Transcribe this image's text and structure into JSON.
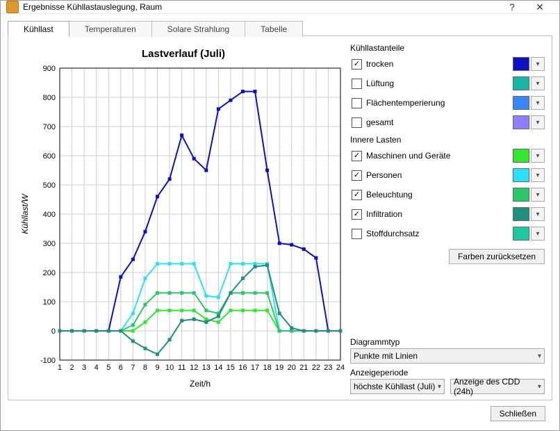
{
  "window_title": "Ergebnisse Kühllastauslegung, Raum",
  "tabs": [
    "Kühllast",
    "Temperaturen",
    "Solare Strahlung",
    "Tabelle"
  ],
  "active_tab": 0,
  "chart_title": "Lastverlauf (Juli)",
  "axis_x_label": "Zeit/h",
  "axis_y_label": "Kühllast/W",
  "groups": {
    "anteile_header": "Kühllastanteile",
    "innere_header": "Innere Lasten"
  },
  "series_anteile": [
    {
      "key": "trocken",
      "label": "trocken",
      "checked": true,
      "color": "#0b10c3"
    },
    {
      "key": "lueftung",
      "label": "Lüftung",
      "checked": false,
      "color": "#17b7a7"
    },
    {
      "key": "flaechentemp",
      "label": "Flächentemperierung",
      "checked": false,
      "color": "#3a86ff"
    },
    {
      "key": "gesamt",
      "label": "gesamt",
      "checked": false,
      "color": "#8d7dff"
    }
  ],
  "series_innere": [
    {
      "key": "maschinen",
      "label": "Maschinen und Geräte",
      "checked": true,
      "color": "#2fe82f"
    },
    {
      "key": "personen",
      "label": "Personen",
      "checked": true,
      "color": "#2be0ff"
    },
    {
      "key": "beleuchtung",
      "label": "Beleuchtung",
      "checked": true,
      "color": "#27c96a"
    },
    {
      "key": "infiltration",
      "label": "Infiltration",
      "checked": true,
      "color": "#1f8f7f"
    },
    {
      "key": "stoffdurchsatz",
      "label": "Stoffdurchsatz",
      "checked": false,
      "color": "#1bc9a0"
    }
  ],
  "reset_colors_label": "Farben zurücksetzen",
  "diagramtype_label": "Diagrammtyp",
  "diagramtype_value": "Punkte mit Linien",
  "period_label": "Anzeigeperiode",
  "period_left_value": "höchste Kühllast (Juli)",
  "period_right_value": "Anzeige des CDD (24h)",
  "close_label": "Schließen",
  "chart_data": {
    "type": "line",
    "title": "Lastverlauf (Juli)",
    "xlabel": "Zeit/h",
    "ylabel": "Kühllast/W",
    "xlim": [
      1,
      24
    ],
    "ylim": [
      -100,
      900
    ],
    "x": [
      1,
      2,
      3,
      4,
      5,
      6,
      7,
      8,
      9,
      10,
      11,
      12,
      13,
      14,
      15,
      16,
      17,
      18,
      19,
      20,
      21,
      22,
      23,
      24
    ],
    "series": [
      {
        "name": "trocken",
        "color": "#0b10c3",
        "values": [
          0,
          0,
          0,
          0,
          0,
          185,
          245,
          340,
          460,
          520,
          670,
          590,
          550,
          760,
          790,
          820,
          820,
          550,
          300,
          295,
          280,
          250,
          0,
          0
        ]
      },
      {
        "name": "Maschinen und Geräte",
        "color": "#2fe82f",
        "values": [
          0,
          0,
          0,
          0,
          0,
          0,
          0,
          30,
          70,
          70,
          70,
          70,
          40,
          30,
          70,
          70,
          70,
          70,
          0,
          0,
          0,
          0,
          0,
          0
        ]
      },
      {
        "name": "Personen",
        "color": "#2be0ff",
        "values": [
          0,
          0,
          0,
          0,
          0,
          0,
          60,
          180,
          230,
          230,
          230,
          230,
          120,
          115,
          230,
          230,
          230,
          230,
          0,
          0,
          0,
          0,
          0,
          0
        ]
      },
      {
        "name": "Beleuchtung",
        "color": "#27c96a",
        "values": [
          0,
          0,
          0,
          0,
          0,
          0,
          20,
          90,
          130,
          130,
          130,
          130,
          70,
          60,
          130,
          130,
          130,
          130,
          0,
          0,
          0,
          0,
          0,
          0
        ]
      },
      {
        "name": "Infiltration",
        "color": "#1f8f7f",
        "values": [
          0,
          0,
          0,
          0,
          0,
          0,
          -35,
          -60,
          -80,
          -30,
          35,
          40,
          30,
          50,
          130,
          180,
          220,
          225,
          60,
          10,
          0,
          0,
          0,
          0
        ]
      }
    ]
  }
}
